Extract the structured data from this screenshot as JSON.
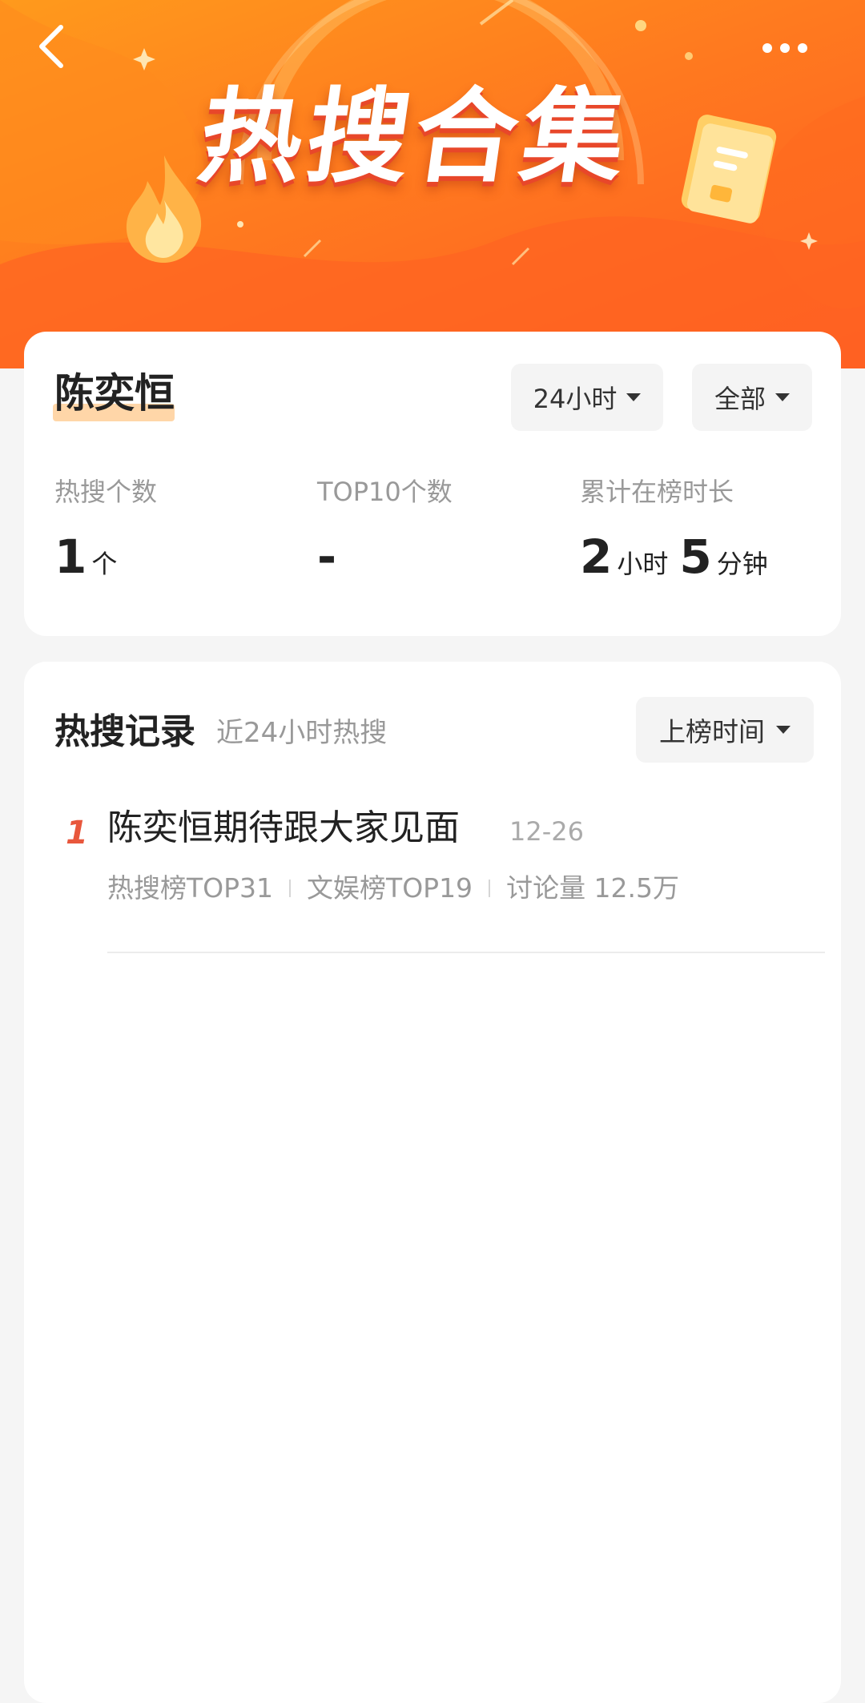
{
  "header": {
    "title": "热搜合集",
    "back_icon": "chevron-left-icon",
    "more_icon": "more-dots-icon",
    "colors": {
      "gradient_start": "#ff9a1c",
      "gradient_end": "#ff5a22"
    }
  },
  "profile": {
    "name": "陈奕恒"
  },
  "filters": {
    "time_range": "24小时",
    "scope": "全部"
  },
  "stats": [
    {
      "label": "热搜个数",
      "value": "1",
      "unit": "个"
    },
    {
      "label": "TOP10个数",
      "value": "-"
    },
    {
      "label": "累计在榜时长",
      "hours": "2",
      "hours_unit": "小时",
      "minutes": "5",
      "minutes_unit": "分钟"
    }
  ],
  "records": {
    "title": "热搜记录",
    "subtitle": "近24小时热搜",
    "sort_label": "上榜时间",
    "items": [
      {
        "rank": "1",
        "title": "陈奕恒期待跟大家见面",
        "date": "12-26",
        "hot_rank": "热搜榜TOP31",
        "ent_rank": "文娱榜TOP19",
        "discussion": "讨论量 12.5万"
      }
    ]
  },
  "colors": {
    "accent": "#e8573c",
    "name_highlight": "#ffd6a8"
  }
}
